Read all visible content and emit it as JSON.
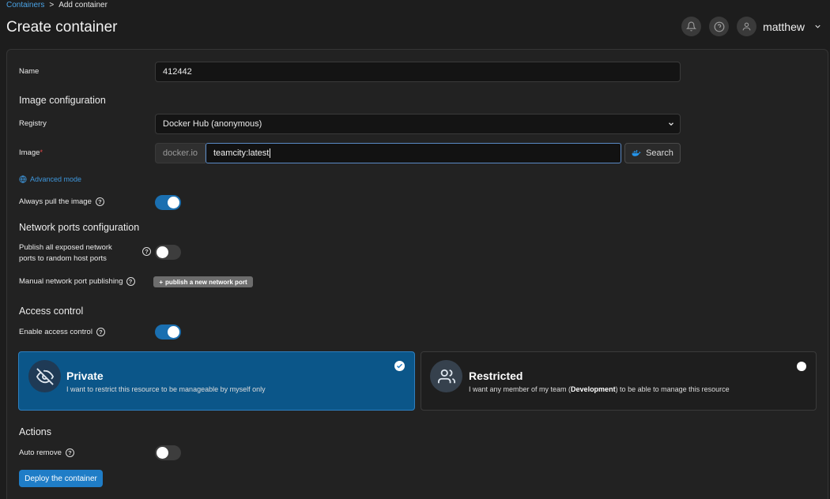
{
  "breadcrumb": {
    "parent": "Containers",
    "separator": ">",
    "current": "Add container"
  },
  "page": {
    "title": "Create container"
  },
  "header": {
    "username": "matthew"
  },
  "form": {
    "name_label": "Name",
    "name_value": "412442",
    "image_section": "Image configuration",
    "registry_label": "Registry",
    "registry_value": "Docker Hub (anonymous)",
    "image_label": "Image",
    "image_required": "*",
    "image_prefix": "docker.io",
    "image_value": "teamcity:latest",
    "search_label": "Search",
    "advanced_mode": "Advanced mode",
    "always_pull_label": "Always pull the image",
    "always_pull_on": true,
    "ports_section": "Network ports configuration",
    "publish_all_label_1": "Publish all exposed network",
    "publish_all_label_2": "ports to random host ports",
    "publish_all_on": false,
    "manual_port_label": "Manual network port publishing",
    "publish_port_button": "publish a new network port",
    "access_section": "Access control",
    "enable_access_label": "Enable access control",
    "enable_access_on": true,
    "private_title": "Private",
    "private_desc": "I want to restrict this resource to be manageable by myself only",
    "restricted_title": "Restricted",
    "restricted_desc_before": "I want any member of my team (",
    "restricted_team": "Development",
    "restricted_desc_after": ") to be able to manage this resource",
    "actions_section": "Actions",
    "auto_remove_label": "Auto remove",
    "auto_remove_on": false,
    "deploy_button": "Deploy the container"
  },
  "icons": {
    "bell": "bell-icon",
    "help": "help-icon",
    "user": "user-icon",
    "chevron": "chevron-down-icon",
    "docker": "docker-icon",
    "globe": "globe-icon",
    "eye_off": "eye-off-icon",
    "users": "users-icon",
    "check": "check-icon"
  },
  "colors": {
    "accent": "#1f7dc7",
    "link": "#3e96db",
    "private_card": "#0b5689"
  }
}
